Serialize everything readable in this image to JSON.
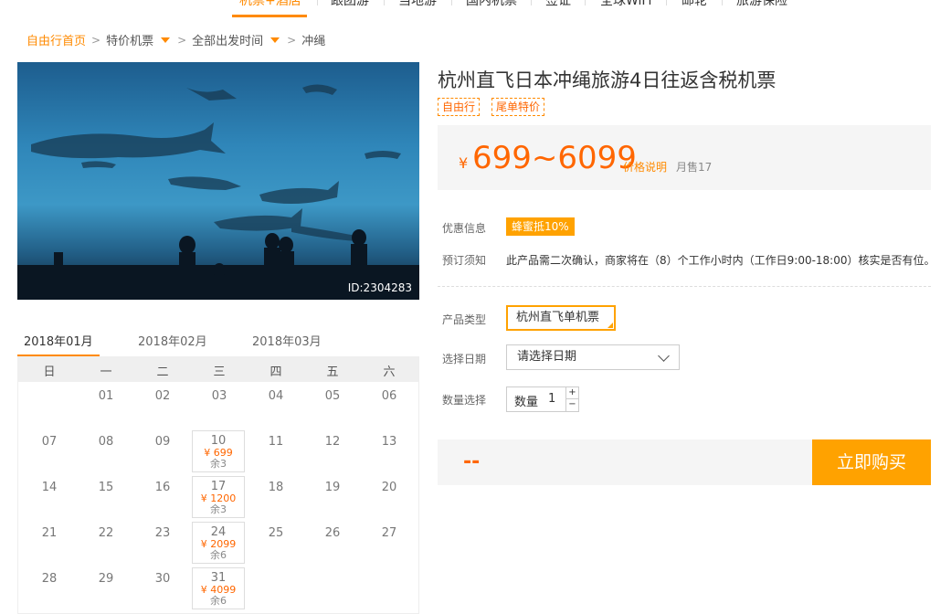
{
  "topnav": {
    "items": [
      {
        "label": "机票+酒店",
        "active": true
      },
      {
        "label": "跟团游"
      },
      {
        "label": "当地游"
      },
      {
        "label": "国内机票"
      },
      {
        "label": "签证"
      },
      {
        "label": "全球WiFi"
      },
      {
        "label": "邮轮"
      },
      {
        "label": "旅游保险"
      }
    ]
  },
  "breadcrumb": {
    "home": "自由行首页",
    "item1": "特价机票",
    "item2": "全部出发时间",
    "current": "冲绳"
  },
  "photo": {
    "id_label": "ID:2304283",
    "icon": "aquarium-photo"
  },
  "product": {
    "title": "杭州直飞日本冲绳旅游4日往返含税机票",
    "tags": [
      "自由行",
      "尾单特价"
    ],
    "currency": "¥",
    "price": "699~6099",
    "price_note": "价格说明",
    "sold": "月售17"
  },
  "info": {
    "discount_label": "优惠信息",
    "discount_badge": "蜂蜜抵10%",
    "notice_label": "预订须知",
    "notice_text": "此产品需二次确认，商家将在（8）个工作小时内（工作日9:00-18:00）核实是否有位。"
  },
  "form": {
    "type_label": "产品类型",
    "type_value": "杭州直飞单机票",
    "date_label": "选择日期",
    "date_placeholder": "请选择日期",
    "qty_label": "数量选择",
    "qty_prefix": "数量",
    "qty_value": "1",
    "plus": "+",
    "minus": "−"
  },
  "buy": {
    "total": "--",
    "button": "立即购买"
  },
  "calendar": {
    "months": [
      "2018年01月",
      "2018年02月",
      "2018年03月"
    ],
    "weekdays": [
      "日",
      "一",
      "二",
      "三",
      "四",
      "五",
      "六"
    ],
    "plain_days": {
      "r1": [
        "01",
        "02",
        "03",
        "04",
        "05",
        "06"
      ],
      "r2": [
        "07",
        "08",
        "09",
        "11",
        "12",
        "13"
      ],
      "r3": [
        "14",
        "15",
        "16",
        "18",
        "19",
        "20"
      ],
      "r4": [
        "21",
        "22",
        "23",
        "25",
        "26",
        "27"
      ],
      "r5": [
        "28",
        "29",
        "30"
      ]
    },
    "priced_days": [
      {
        "day": "10",
        "price": "¥ 699",
        "stock": "余3"
      },
      {
        "day": "17",
        "price": "¥ 1200",
        "stock": "余3"
      },
      {
        "day": "24",
        "price": "¥ 2099",
        "stock": "余6"
      },
      {
        "day": "31",
        "price": "¥ 4099",
        "stock": "余6"
      }
    ]
  },
  "colors": {
    "accent": "#ff8a00",
    "price": "#ff6600",
    "button": "#ffa200"
  }
}
